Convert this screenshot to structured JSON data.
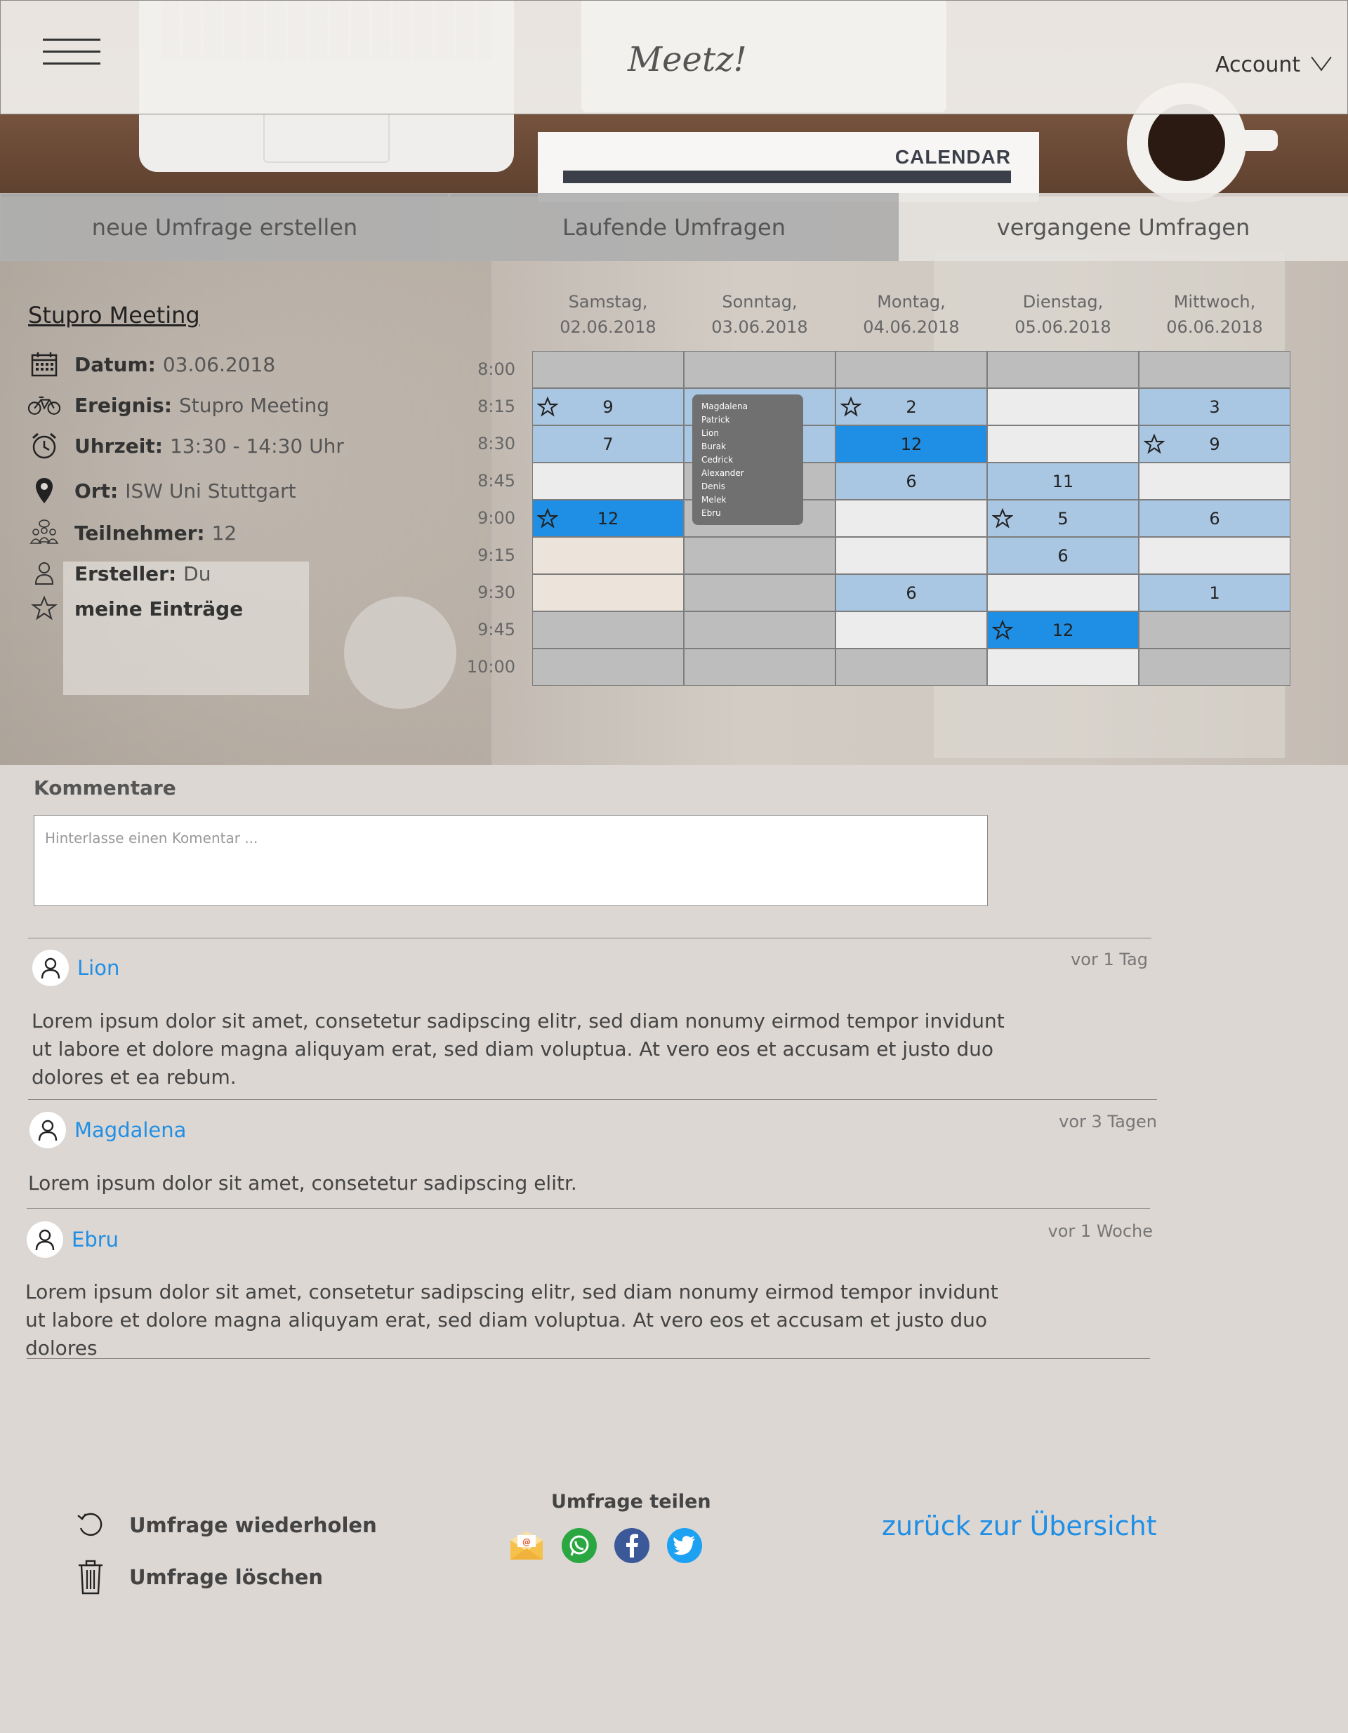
{
  "header": {
    "logo": "Meetz!",
    "account_label": "Account",
    "background_card_label": "CALENDAR"
  },
  "tabs": [
    {
      "label": "neue Umfrage erstellen",
      "active": false
    },
    {
      "label": "Laufende Umfragen",
      "active": false
    },
    {
      "label": "vergangene Umfragen",
      "active": true
    }
  ],
  "meeting": {
    "title": "Stupro Meeting",
    "rows": [
      {
        "icon": "calendar-icon",
        "label": "Datum:",
        "value": "03.06.2018"
      },
      {
        "icon": "bicycle-icon",
        "label": "Ereignis:",
        "value": "Stupro Meeting"
      },
      {
        "icon": "alarm-clock-icon",
        "label": "Uhrzeit:",
        "value": "13:30 - 14:30 Uhr"
      },
      {
        "icon": "location-pin-icon",
        "label": "Ort:",
        "value": "ISW Uni Stuttgart"
      },
      {
        "icon": "participants-icon",
        "label": "Teilnehmer:",
        "value": "12"
      },
      {
        "icon": "user-icon",
        "label": "Ersteller:",
        "value": "Du"
      },
      {
        "icon": "star-icon",
        "label": "meine Einträge",
        "value": ""
      }
    ]
  },
  "schedule": {
    "days": [
      {
        "name": "Samstag,",
        "date": "02.06.2018"
      },
      {
        "name": "Sonntag,",
        "date": "03.06.2018"
      },
      {
        "name": "Montag,",
        "date": "04.06.2018"
      },
      {
        "name": "Dienstag,",
        "date": "05.06.2018"
      },
      {
        "name": "Mittwoch,",
        "date": "06.06.2018"
      }
    ],
    "times": [
      "8:00",
      "8:15",
      "8:30",
      "8:45",
      "9:00",
      "9:15",
      "9:30",
      "9:45",
      "10:00"
    ],
    "legend_colors": {
      "unavailable": "#bdbdbd",
      "light": "#a9c6e2",
      "strong": "#1f8fe6",
      "free": "#ececec"
    },
    "rows": [
      [
        {
          "s": "gray"
        },
        {
          "s": "gray"
        },
        {
          "s": "gray"
        },
        {
          "s": "gray"
        },
        {
          "s": "gray"
        }
      ],
      [
        {
          "s": "light",
          "v": "9",
          "star": true
        },
        {
          "s": "light"
        },
        {
          "s": "light",
          "v": "2",
          "star": true
        },
        {
          "s": "white"
        },
        {
          "s": "light",
          "v": "3"
        }
      ],
      [
        {
          "s": "light",
          "v": "7"
        },
        {
          "s": "light"
        },
        {
          "s": "blue",
          "v": "12"
        },
        {
          "s": "white"
        },
        {
          "s": "light",
          "v": "9",
          "star": true
        }
      ],
      [
        {
          "s": "white"
        },
        {
          "s": "gray"
        },
        {
          "s": "light",
          "v": "6"
        },
        {
          "s": "light",
          "v": "11"
        },
        {
          "s": "white"
        }
      ],
      [
        {
          "s": "blue",
          "v": "12",
          "star": true
        },
        {
          "s": "gray"
        },
        {
          "s": "white"
        },
        {
          "s": "light",
          "v": "5",
          "star": true
        },
        {
          "s": "light",
          "v": "6"
        }
      ],
      [
        {
          "s": "beige"
        },
        {
          "s": "gray"
        },
        {
          "s": "white"
        },
        {
          "s": "light",
          "v": "6"
        },
        {
          "s": "white"
        }
      ],
      [
        {
          "s": "beige"
        },
        {
          "s": "gray"
        },
        {
          "s": "light",
          "v": "6"
        },
        {
          "s": "white"
        },
        {
          "s": "light",
          "v": "1"
        }
      ],
      [
        {
          "s": "gray"
        },
        {
          "s": "gray"
        },
        {
          "s": "white"
        },
        {
          "s": "blue",
          "v": "12",
          "star": true
        },
        {
          "s": "gray"
        }
      ],
      [
        {
          "s": "gray"
        },
        {
          "s": "gray"
        },
        {
          "s": "gray"
        },
        {
          "s": "white"
        },
        {
          "s": "gray"
        }
      ]
    ],
    "popup_names": [
      "Magdalena",
      "Patrick",
      "Lion",
      "Burak",
      "Cedrick",
      "Alexander",
      "Denis",
      "Melek",
      "Ebru"
    ]
  },
  "comments": {
    "heading": "Kommentare",
    "input_placeholder": "Hinterlasse einen Komentar ...",
    "items": [
      {
        "author": "Lion",
        "time": "vor 1 Tag",
        "text": "Lorem ipsum dolor sit amet, consetetur sadipscing elitr, sed diam nonumy eirmod tempor invidunt ut labore et dolore magna aliquyam erat, sed diam voluptua. At vero eos et accusam et justo duo dolores et ea rebum."
      },
      {
        "author": "Magdalena",
        "time": "vor 3 Tagen",
        "text": "Lorem ipsum dolor sit amet, consetetur sadipscing elitr."
      },
      {
        "author": "Ebru",
        "time": "vor 1 Woche",
        "text": "Lorem ipsum dolor sit amet, consetetur sadipscing elitr, sed diam nonumy eirmod tempor invidunt ut labore et dolore magna aliquyam erat, sed diam voluptua. At vero eos et accusam et justo duo dolores"
      }
    ]
  },
  "footer": {
    "repeat_label": "Umfrage wiederholen",
    "delete_label": "Umfrage löschen",
    "share_label": "Umfrage teilen",
    "share_icons": [
      "email-icon",
      "whatsapp-icon",
      "facebook-icon",
      "twitter-icon"
    ],
    "back_link": "zurück zur Übersicht"
  }
}
